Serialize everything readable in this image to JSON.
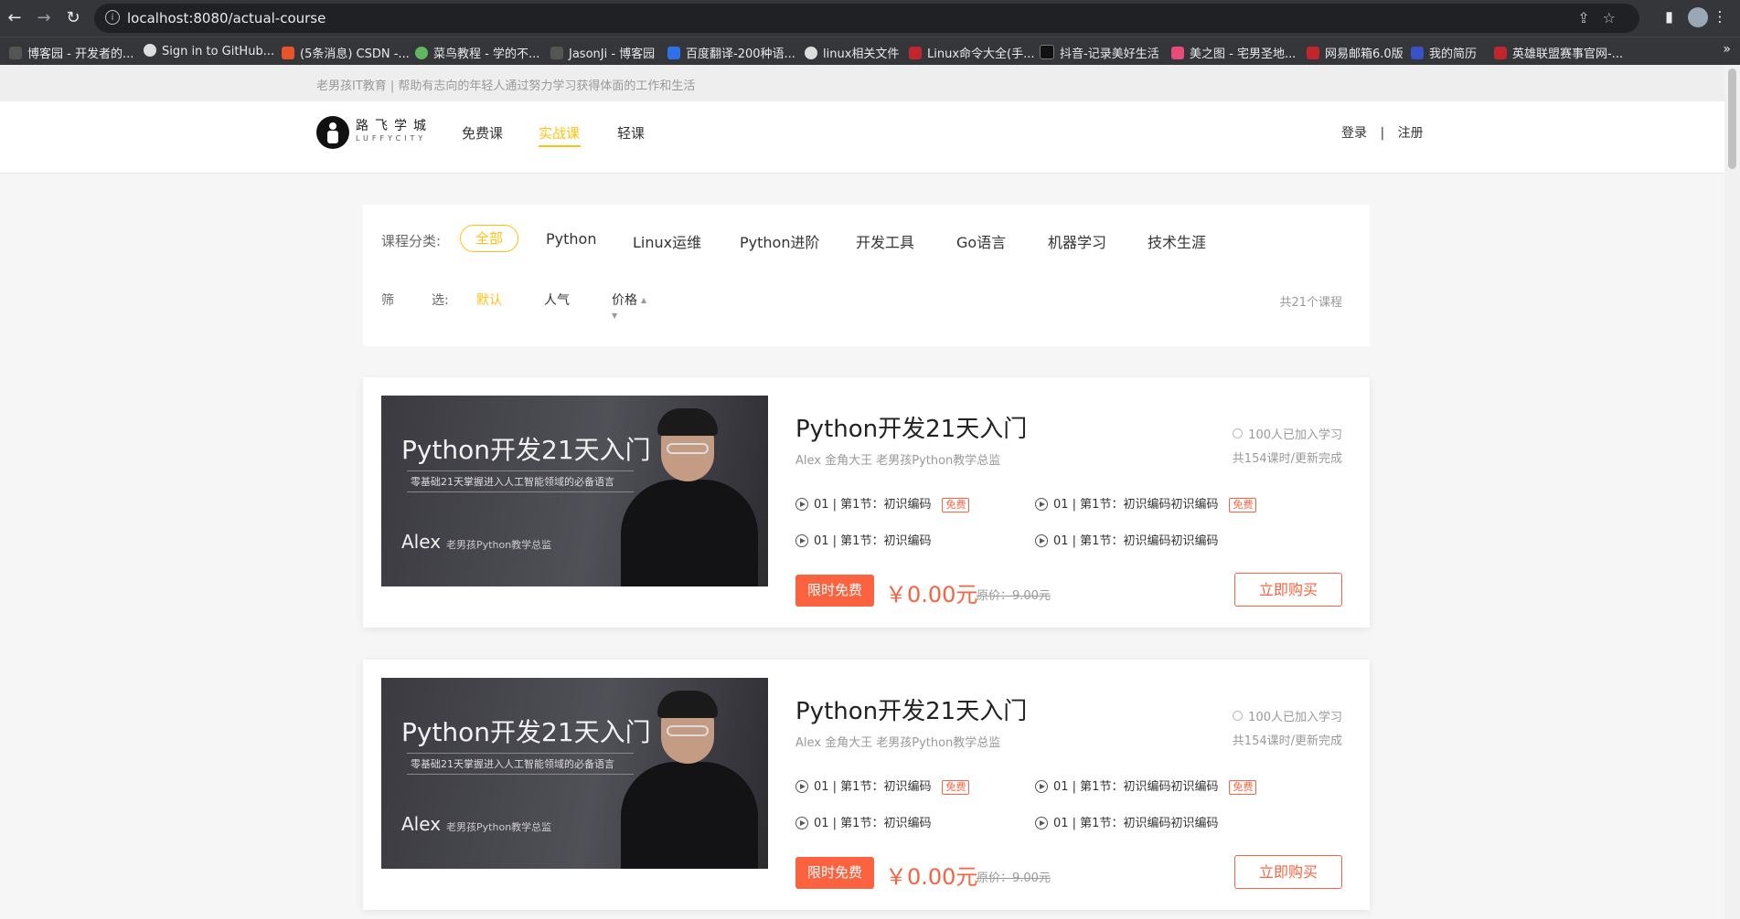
{
  "browser": {
    "url": "localhost:8080/actual-course",
    "bookmarks": [
      {
        "label": "博客园 - 开发者的...",
        "color": "#555"
      },
      {
        "label": "Sign in to GitHub...",
        "color": "#ddd"
      },
      {
        "label": "(5条消息) CSDN -...",
        "color": "#e8532a"
      },
      {
        "label": "菜鸟教程 - 学的不...",
        "color": "#5fb85f"
      },
      {
        "label": "JasonJi - 博客园",
        "color": "#555"
      },
      {
        "label": "百度翻译-200种语...",
        "color": "#3070e8"
      },
      {
        "label": "linux相关文件",
        "color": "#ddd"
      },
      {
        "label": "Linux命令大全(手...",
        "color": "#c0262c"
      },
      {
        "label": "抖音-记录美好生活",
        "color": "#111"
      },
      {
        "label": "美之图 - 宅男圣地...",
        "color": "#e84a7a"
      },
      {
        "label": "网易邮箱6.0版",
        "color": "#c0262c"
      },
      {
        "label": "我的简历",
        "color": "#3a52c8"
      },
      {
        "label": "英雄联盟赛事官网-...",
        "color": "#c0262c"
      }
    ],
    "bookmarks_more": "»"
  },
  "site": {
    "tagline": "老男孩IT教育 | 帮助有志向的年轻人通过努力学习获得体面的工作和生活",
    "logo_cn": "路飞学城",
    "logo_en": "LUFFYCITY",
    "nav": [
      "免费课",
      "实战课",
      "轻课"
    ],
    "login": "登录",
    "separator": "|",
    "register": "注册"
  },
  "filter": {
    "category_label": "课程分类:",
    "categories": [
      "全部",
      "Python",
      "Linux运维",
      "Python进阶",
      "开发工具",
      "Go语言",
      "机器学习",
      "技术生涯"
    ],
    "sort_label_1": "筛",
    "sort_label_2": "选:",
    "sorts": [
      "默认",
      "人气",
      "价格"
    ],
    "total": "共21个课程"
  },
  "courses": [
    {
      "thumb_title": "Python开发21天入门",
      "thumb_sub": "零基础21天掌握进入人工智能领域的必备语言",
      "thumb_author": "Alex",
      "thumb_author_role": "老男孩Python教学总监",
      "title": "Python开发21天入门",
      "teacher": "Alex 金角大王 老男孩Python教学总监",
      "students": "100人已加入学习",
      "hours": "共154课时/更新完成",
      "lessons": [
        "01 | 第1节：初识编码",
        "01 | 第1节：初识编码初识编码",
        "01 | 第1节：初识编码",
        "01 | 第1节：初识编码初识编码"
      ],
      "free_tag": "免费",
      "promo": "限时免费",
      "price": "￥0.00元",
      "original_price": "原价：9.00元",
      "buy": "立即购买"
    },
    {
      "thumb_title": "Python开发21天入门",
      "thumb_sub": "零基础21天掌握进入人工智能领域的必备语言",
      "thumb_author": "Alex",
      "thumb_author_role": "老男孩Python教学总监",
      "title": "Python开发21天入门",
      "teacher": "Alex 金角大王 老男孩Python教学总监",
      "students": "100人已加入学习",
      "hours": "共154课时/更新完成",
      "lessons": [
        "01 | 第1节：初识编码",
        "01 | 第1节：初识编码初识编码",
        "01 | 第1节：初识编码",
        "01 | 第1节：初识编码初识编码"
      ],
      "free_tag": "免费",
      "promo": "限时免费",
      "price": "￥0.00元",
      "original_price": "原价：9.00元",
      "buy": "立即购买"
    }
  ],
  "colors": {
    "accent": "#ffc210",
    "price": "#fa6240"
  }
}
